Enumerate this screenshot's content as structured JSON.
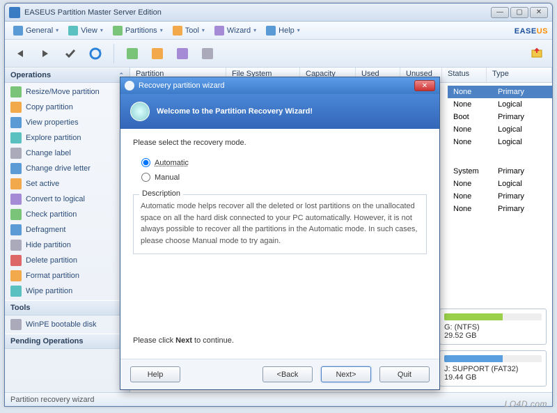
{
  "titlebar": {
    "title": "EASEUS Partition Master Server Edition"
  },
  "brand": {
    "part1": "EASE",
    "part2": "US"
  },
  "menu": {
    "items": [
      {
        "label": "General",
        "icon": "ic-blue"
      },
      {
        "label": "View",
        "icon": "ic-teal"
      },
      {
        "label": "Partitions",
        "icon": "ic-green"
      },
      {
        "label": "Tool",
        "icon": "ic-orange"
      },
      {
        "label": "Wizard",
        "icon": "ic-purple"
      },
      {
        "label": "Help",
        "icon": "ic-blue"
      }
    ]
  },
  "sidebar": {
    "operations_header": "Operations",
    "ops": [
      {
        "label": "Resize/Move partition",
        "icon": "ic-green"
      },
      {
        "label": "Copy partition",
        "icon": "ic-orange"
      },
      {
        "label": "View properties",
        "icon": "ic-blue"
      },
      {
        "label": "Explore partition",
        "icon": "ic-teal"
      },
      {
        "label": "Change label",
        "icon": "ic-gray"
      },
      {
        "label": "Change drive letter",
        "icon": "ic-blue"
      },
      {
        "label": "Set active",
        "icon": "ic-orange"
      },
      {
        "label": "Convert to logical",
        "icon": "ic-purple"
      },
      {
        "label": "Check partition",
        "icon": "ic-green"
      },
      {
        "label": "Defragment",
        "icon": "ic-blue"
      },
      {
        "label": "Hide partition",
        "icon": "ic-gray"
      },
      {
        "label": "Delete partition",
        "icon": "ic-red"
      },
      {
        "label": "Format partition",
        "icon": "ic-orange"
      },
      {
        "label": "Wipe partition",
        "icon": "ic-teal"
      }
    ],
    "tools_header": "Tools",
    "tools": [
      {
        "label": "WinPE bootable disk",
        "icon": "ic-gray"
      }
    ],
    "pending_header": "Pending Operations"
  },
  "columns": {
    "c0": "Partition",
    "c1": "File System",
    "c2": "Capacity",
    "c3": "Used",
    "c4": "Unused",
    "c5": "Status",
    "c6": "Type"
  },
  "rows_right": [
    {
      "status": "None",
      "type": "Primary",
      "sel": true
    },
    {
      "status": "None",
      "type": "Logical",
      "sel": false
    },
    {
      "status": "Boot",
      "type": "Primary",
      "sel": false
    },
    {
      "status": "None",
      "type": "Logical",
      "sel": false
    },
    {
      "status": "None",
      "type": "Logical",
      "sel": false
    }
  ],
  "rows_right2": [
    {
      "status": "System",
      "type": "Primary"
    },
    {
      "status": "None",
      "type": "Logical"
    },
    {
      "status": "None",
      "type": "Primary"
    },
    {
      "status": "None",
      "type": "Primary"
    }
  ],
  "disks": [
    {
      "label": "G: (NTFS)",
      "size": "29.52 GB",
      "color": "#9ad04a"
    },
    {
      "label": "J: SUPPORT (FAT32)",
      "size": "19.44 GB",
      "color": "#5aa0e0"
    }
  ],
  "statusbar": {
    "text": "Partition recovery wizard"
  },
  "watermark": "LO4D.com",
  "dialog": {
    "title": "Recovery partition wizard",
    "banner": "Welcome to the Partition Recovery Wizard!",
    "prompt": "Please select the recovery mode.",
    "opt_auto": "Automatic",
    "opt_manual": "Manual",
    "desc_legend": "Description",
    "desc_text": "Automatic mode helps recover all the deleted or lost partitions on the unallocated space on all the hard disk connected to your PC automatically. However, it is not always possible to recover all the partitions in the Automatic mode. In such cases, please choose Manual mode to try again.",
    "continue_prefix": "Please click ",
    "continue_bold": "Next",
    "continue_suffix": " to continue.",
    "btn_help": "Help",
    "btn_back": "<Back",
    "btn_next": "Next>",
    "btn_quit": "Quit"
  }
}
